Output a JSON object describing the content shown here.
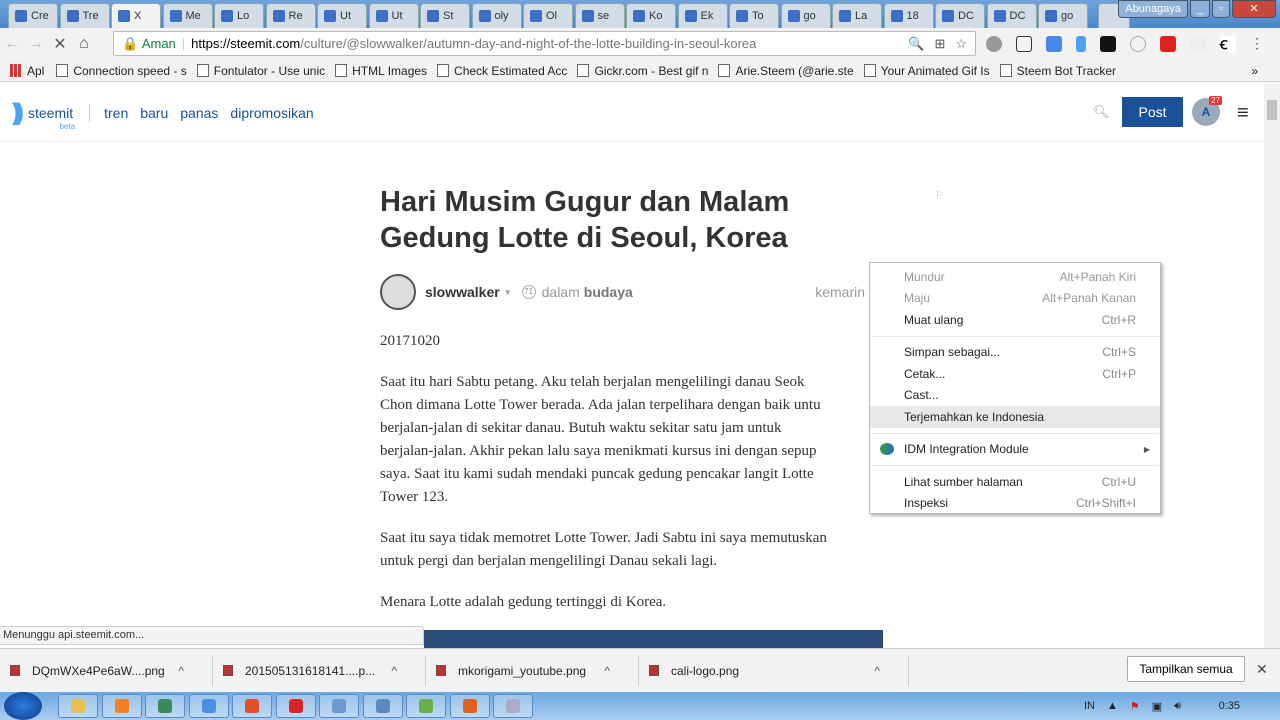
{
  "browser": {
    "tabs": [
      {
        "label": "Cre",
        "icon": "steemit"
      },
      {
        "label": "Tre",
        "icon": "steemit"
      },
      {
        "label": "X",
        "icon": "loading",
        "active": true
      },
      {
        "label": "Me",
        "icon": "steemit"
      },
      {
        "label": "Lo",
        "icon": "leaf"
      },
      {
        "label": "Re",
        "icon": "steemit"
      },
      {
        "label": "Ut",
        "icon": "steemit"
      },
      {
        "label": "Ut",
        "icon": "steemit"
      },
      {
        "label": "St",
        "icon": "list"
      },
      {
        "label": "oly",
        "icon": "google"
      },
      {
        "label": "Ol",
        "icon": "circle"
      },
      {
        "label": "se",
        "icon": "google"
      },
      {
        "label": "Ko",
        "icon": "emblem"
      },
      {
        "label": "Ek",
        "icon": "puzzle"
      },
      {
        "label": "To",
        "icon": "drive"
      },
      {
        "label": "go",
        "icon": "google"
      },
      {
        "label": "La",
        "icon": "steemit"
      },
      {
        "label": "18",
        "icon": "spinner"
      },
      {
        "label": "DC",
        "icon": "doc"
      },
      {
        "label": "DC",
        "icon": "doc"
      },
      {
        "label": "go",
        "icon": "doc"
      }
    ],
    "user": "Abunagaya",
    "secure_label": "Aman",
    "url_host": "https://steemit.com",
    "url_path": "/culture/@slowwalker/autumn-day-and-night-of-the-lotte-building-in-seoul-korea",
    "bookmarks": [
      "Apl",
      "Connection speed - s",
      "Fontulator - Use unic",
      "HTML Images",
      "Check Estimated Acc",
      "Gickr.com - Best gif n",
      "Arie.Steem (@arie.ste",
      "Your Animated Gif Is",
      "Steem Bot Tracker"
    ],
    "more": "»",
    "status": "Menunggu api.steemit.com..."
  },
  "site": {
    "logo": "steemit",
    "beta": "beta",
    "nav": [
      "tren",
      "baru",
      "panas",
      "dipromosikan"
    ],
    "post_label": "Post",
    "avatar_letter": "A",
    "notifications": "27"
  },
  "article": {
    "title": "Hari Musim Gugur dan Malam Gedung Lotte di Seoul, Korea",
    "author": "slowwalker",
    "reputation": "71",
    "in_label": "dalam",
    "category": "budaya",
    "time": "kemarin",
    "paragraphs": [
      "20171020",
      "Saat itu hari Sabtu petang. Aku telah berjalan mengelilingi danau Seok\nChon dimana Lotte Tower berada. Ada jalan terpelihara dengan baik untu\nberjalan-jalan di sekitar danau. Butuh waktu sekitar satu jam untuk\nberjalan-jalan. Akhir pekan lalu saya menikmati kursus ini dengan sepup\nsaya. Saat itu kami sudah mendaki puncak gedung pencakar langit Lotte\nTower 123.",
      "Saat itu saya tidak memotret Lotte Tower. Jadi Sabtu ini saya memutuskan\nuntuk pergi dan berjalan mengelilingi Danau sekali lagi.",
      "Menara Lotte adalah gedung tertinggi di Korea."
    ]
  },
  "context_menu": [
    {
      "label": "Mundur",
      "shortcut": "Alt+Panah Kiri",
      "disabled": true
    },
    {
      "label": "Maju",
      "shortcut": "Alt+Panah Kanan",
      "disabled": true
    },
    {
      "label": "Muat ulang",
      "shortcut": "Ctrl+R"
    },
    {
      "sep": true
    },
    {
      "label": "Simpan sebagai...",
      "shortcut": "Ctrl+S"
    },
    {
      "label": "Cetak...",
      "shortcut": "Ctrl+P"
    },
    {
      "label": "Cast...",
      "shortcut": ""
    },
    {
      "label": "Terjemahkan ke Indonesia",
      "shortcut": "",
      "highlighted": true
    },
    {
      "sep": true
    },
    {
      "label": "IDM Integration Module",
      "shortcut": "",
      "submenu": true,
      "icon": "idm"
    },
    {
      "sep": true
    },
    {
      "label": "Lihat sumber halaman",
      "shortcut": "Ctrl+U"
    },
    {
      "label": "Inspeksi",
      "shortcut": "Ctrl+Shift+I"
    }
  ],
  "downloads": {
    "items": [
      "DQmWXe4Pe6aW....png",
      "201505131618141....p...",
      "mkorigami_youtube.png",
      "cali-logo.png"
    ],
    "show_all": "Tampilkan semua"
  },
  "taskbar": {
    "lang": "IN",
    "time": "0:35",
    "apps": [
      "explorer",
      "media",
      "window",
      "chrome",
      "app",
      "app",
      "window",
      "window",
      "app",
      "firefox",
      "window"
    ]
  }
}
